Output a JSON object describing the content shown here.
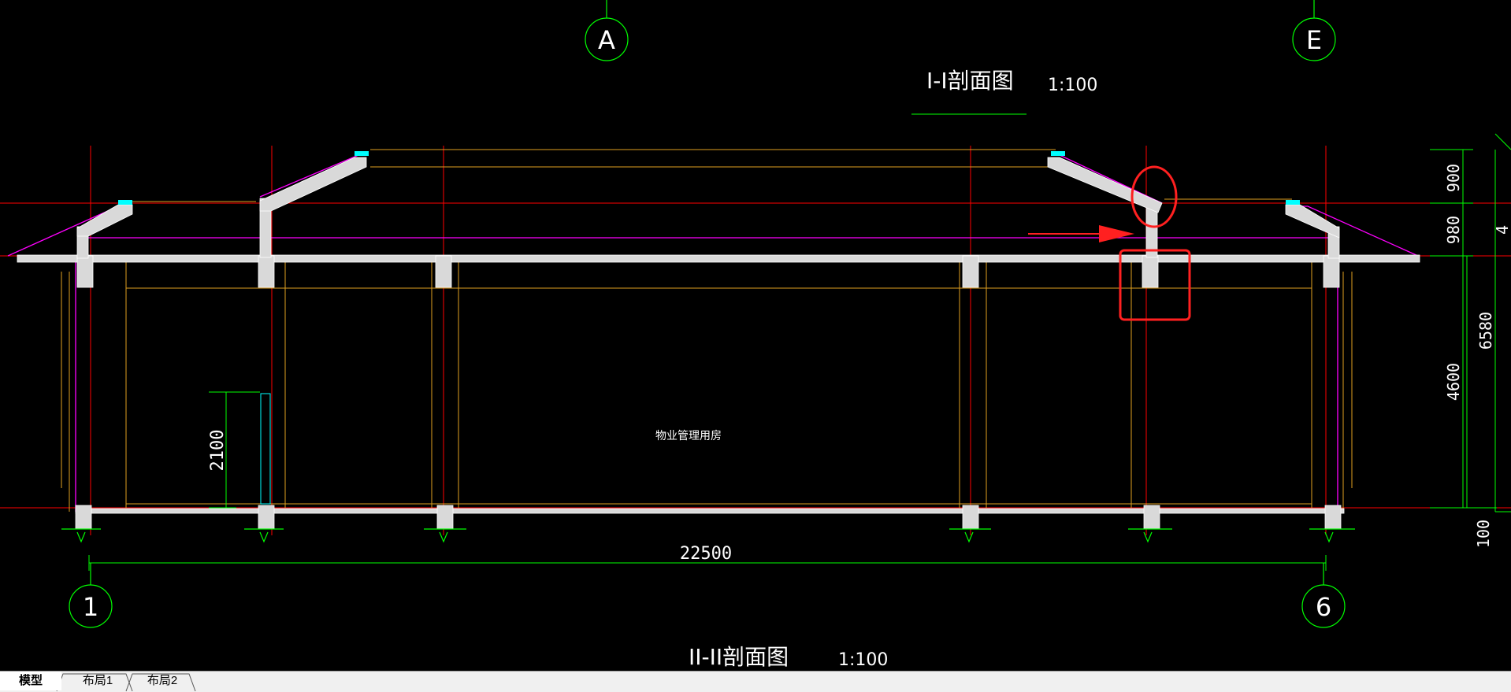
{
  "drawing": {
    "title_top": "I-I剖面图",
    "scale_top": "1:100",
    "title_bottom": "II-II剖面图",
    "scale_bottom": "1:100",
    "room_label": "物业管理用房",
    "axis_labels": {
      "a": "A",
      "e": "E",
      "one": "1",
      "six": "6"
    },
    "dimensions": {
      "overall_width": "22500",
      "door_height": "2100",
      "right_900": "900",
      "right_980": "980",
      "right_4600": "4600",
      "right_6580": "6580",
      "right_100": "100",
      "right_partial": "4"
    },
    "colors": {
      "background": "#000000",
      "axis_line": "#ff0000",
      "wall_fill": "#d9d9d9",
      "frame_line": "#e0a020",
      "dimension": "#00ff00",
      "roof_magenta": "#ff00ff",
      "annotation": "#ff2020"
    }
  },
  "tabs": [
    {
      "label": "模型",
      "active": true
    },
    {
      "label": "布局1",
      "active": false
    },
    {
      "label": "布局2",
      "active": false
    }
  ]
}
